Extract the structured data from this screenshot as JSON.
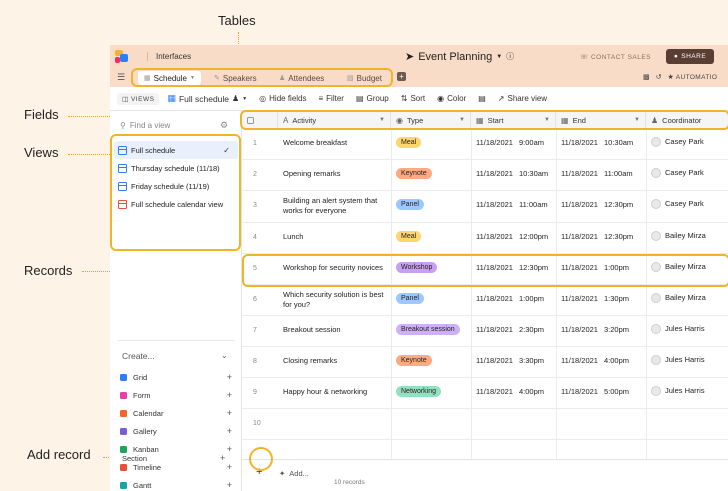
{
  "callouts": {
    "tables": "Tables",
    "fields": "Fields",
    "views": "Views",
    "records": "Records",
    "add_record": "Add record"
  },
  "topbar": {
    "interfaces": "Interfaces",
    "base_title": "Event Planning",
    "contact_sales": "CONTACT SALES",
    "share": "SHARE"
  },
  "tabs": [
    {
      "label": "Schedule"
    },
    {
      "label": "Speakers"
    },
    {
      "label": "Attendees"
    },
    {
      "label": "Budget"
    }
  ],
  "tabbar_right": {
    "automations": "AUTOMATIO"
  },
  "viewbar": {
    "views": "VIEWS",
    "current_view": "Full schedule",
    "hide_fields": "Hide fields",
    "filter": "Filter",
    "group": "Group",
    "sort": "Sort",
    "color": "Color",
    "share_view": "Share view"
  },
  "sidebar": {
    "find_placeholder": "Find a view",
    "views": [
      {
        "label": "Full schedule"
      },
      {
        "label": "Thursday schedule (11/18)"
      },
      {
        "label": "Friday schedule (11/19)"
      },
      {
        "label": "Full schedule calendar view"
      }
    ],
    "create": "Create...",
    "create_items": [
      {
        "label": "Grid",
        "color": "#2d7ff9"
      },
      {
        "label": "Form",
        "color": "#e83fa5"
      },
      {
        "label": "Calendar",
        "color": "#f2652a"
      },
      {
        "label": "Gallery",
        "color": "#7c5cd6"
      },
      {
        "label": "Kanban",
        "color": "#20a35a"
      },
      {
        "label": "Timeline",
        "color": "#e8503c"
      },
      {
        "label": "Gantt",
        "color": "#1aa3a3"
      }
    ],
    "section": "Section"
  },
  "grid": {
    "headers": {
      "activity": "Activity",
      "type": "Type",
      "start": "Start",
      "end": "End",
      "coordinator": "Coordinator"
    },
    "rows": [
      {
        "num": "1",
        "activity": "Welcome breakfast",
        "type": "Meal",
        "sdate": "11/18/2021",
        "stime": "9:00am",
        "edate": "11/18/2021",
        "etime": "10:30am",
        "coord": "Casey Park"
      },
      {
        "num": "2",
        "activity": "Opening remarks",
        "type": "Keynote",
        "sdate": "11/18/2021",
        "stime": "10:30am",
        "edate": "11/18/2021",
        "etime": "11:00am",
        "coord": "Casey Park"
      },
      {
        "num": "3",
        "activity": "Building an alert system that works for everyone",
        "type": "Panel",
        "sdate": "11/18/2021",
        "stime": "11:00am",
        "edate": "11/18/2021",
        "etime": "12:30pm",
        "coord": "Casey Park"
      },
      {
        "num": "4",
        "activity": "Lunch",
        "type": "Meal",
        "sdate": "11/18/2021",
        "stime": "12:00pm",
        "edate": "11/18/2021",
        "etime": "12:30pm",
        "coord": "Bailey Mirza"
      },
      {
        "num": "5",
        "activity": "Workshop for security novices",
        "type": "Workshop",
        "sdate": "11/18/2021",
        "stime": "12:30pm",
        "edate": "11/18/2021",
        "etime": "1:00pm",
        "coord": "Bailey Mirza"
      },
      {
        "num": "6",
        "activity": "Which security solution is best for you?",
        "type": "Panel",
        "sdate": "11/18/2021",
        "stime": "1:00pm",
        "edate": "11/18/2021",
        "etime": "1:30pm",
        "coord": "Bailey Mirza"
      },
      {
        "num": "7",
        "activity": "Breakout session",
        "type": "Breakout session",
        "sdate": "11/18/2021",
        "stime": "2:30pm",
        "edate": "11/18/2021",
        "etime": "3:20pm",
        "coord": "Jules Harris"
      },
      {
        "num": "8",
        "activity": "Closing remarks",
        "type": "Keynote",
        "sdate": "11/18/2021",
        "stime": "3:30pm",
        "edate": "11/18/2021",
        "etime": "4:00pm",
        "coord": "Jules Harris"
      },
      {
        "num": "9",
        "activity": "Happy hour & networking",
        "type": "Networking",
        "sdate": "11/18/2021",
        "stime": "4:00pm",
        "edate": "11/18/2021",
        "etime": "5:00pm",
        "coord": "Jules Harris"
      },
      {
        "num": "10",
        "activity": "",
        "type": "",
        "sdate": "",
        "stime": "",
        "edate": "",
        "etime": "",
        "coord": ""
      }
    ],
    "type_colors": {
      "Meal": "#ffd66e",
      "Keynote": "#ffa981",
      "Panel": "#9cc7ff",
      "Workshop": "#c9a0f0",
      "Breakout session": "#cdb0f5",
      "Networking": "#93e0c0"
    },
    "footer": {
      "add": "Add...",
      "records": "10 records"
    }
  }
}
